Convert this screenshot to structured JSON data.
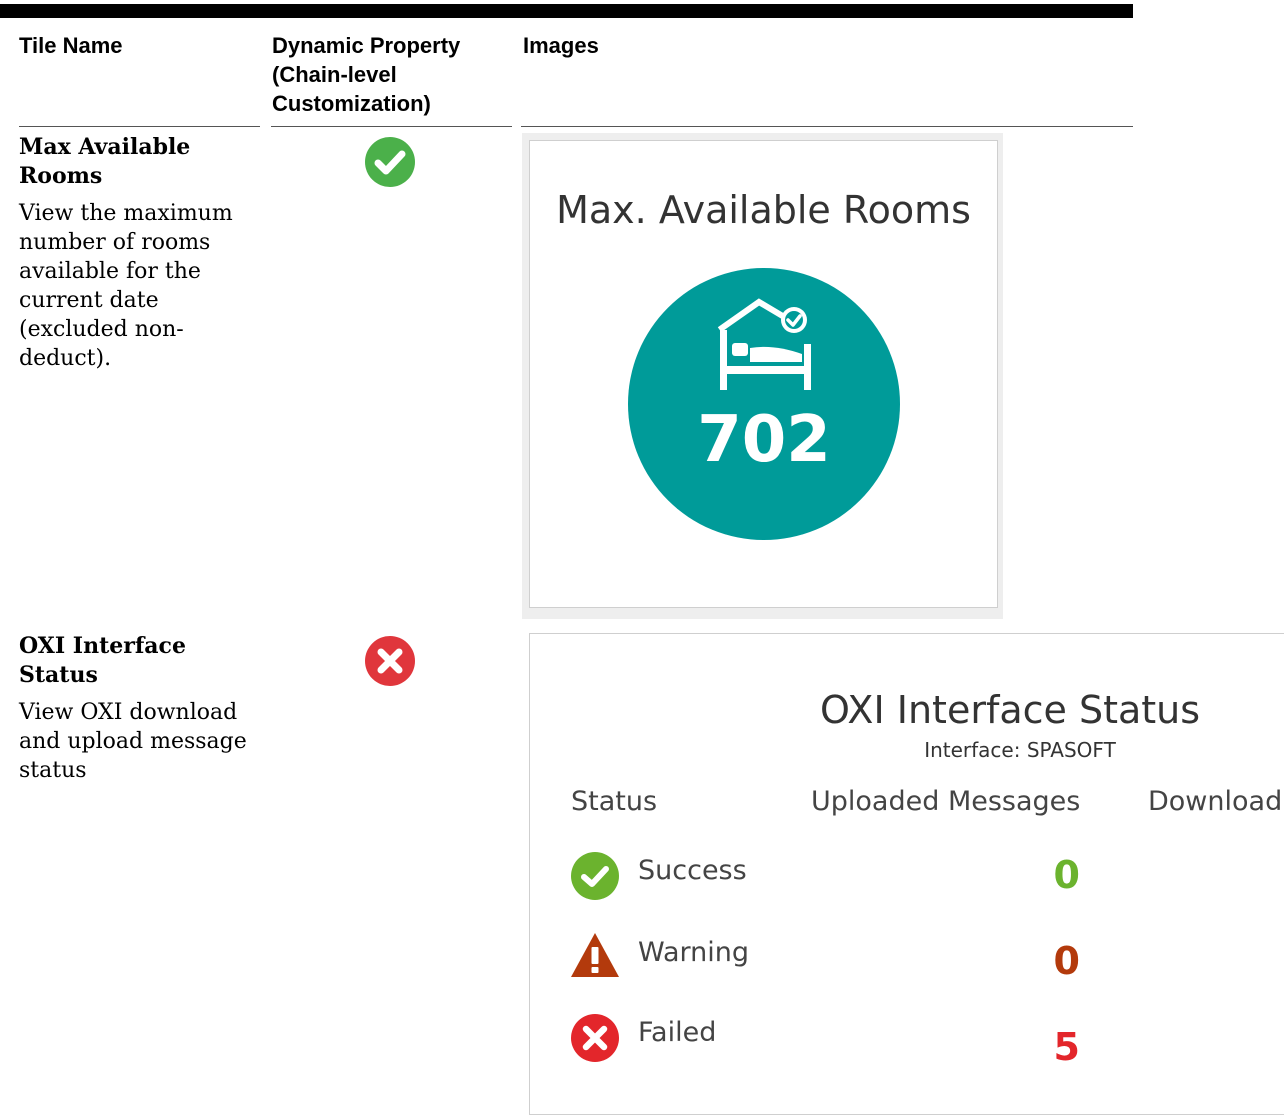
{
  "table": {
    "headers": [
      "Tile Name",
      "Dynamic Property (Chain-level Customization)",
      "Images"
    ],
    "rows": [
      {
        "name": "Max Available Rooms",
        "description": "View the maximum number of rooms available for the current date (excluded non-deduct).",
        "dynamic_property": "check-circle-icon"
      },
      {
        "name": "OXI Interface Status",
        "description": "View OXI download and upload message status",
        "dynamic_property": "x-circle-icon"
      }
    ]
  },
  "tile_max_rooms": {
    "title": "Max. Available Rooms",
    "value": "702",
    "icon": "bed-check-icon",
    "circle_color": "#009b99"
  },
  "tile_oxi": {
    "title": "OXI Interface Status",
    "subtitle": "Interface: SPASOFT",
    "columns": [
      "Status",
      "Uploaded Messages",
      "Download"
    ],
    "statuses": [
      {
        "label": "Success",
        "uploaded": "0",
        "icon": "check-circle-icon",
        "color": "#6bb32e"
      },
      {
        "label": "Warning",
        "uploaded": "0",
        "icon": "warning-triangle-icon",
        "color": "#b33a0c"
      },
      {
        "label": "Failed",
        "uploaded": "5",
        "icon": "x-circle-icon",
        "color": "#e3262b"
      }
    ]
  },
  "colors": {
    "check_green": "#4bb04a",
    "error_red": "#e0363c"
  }
}
